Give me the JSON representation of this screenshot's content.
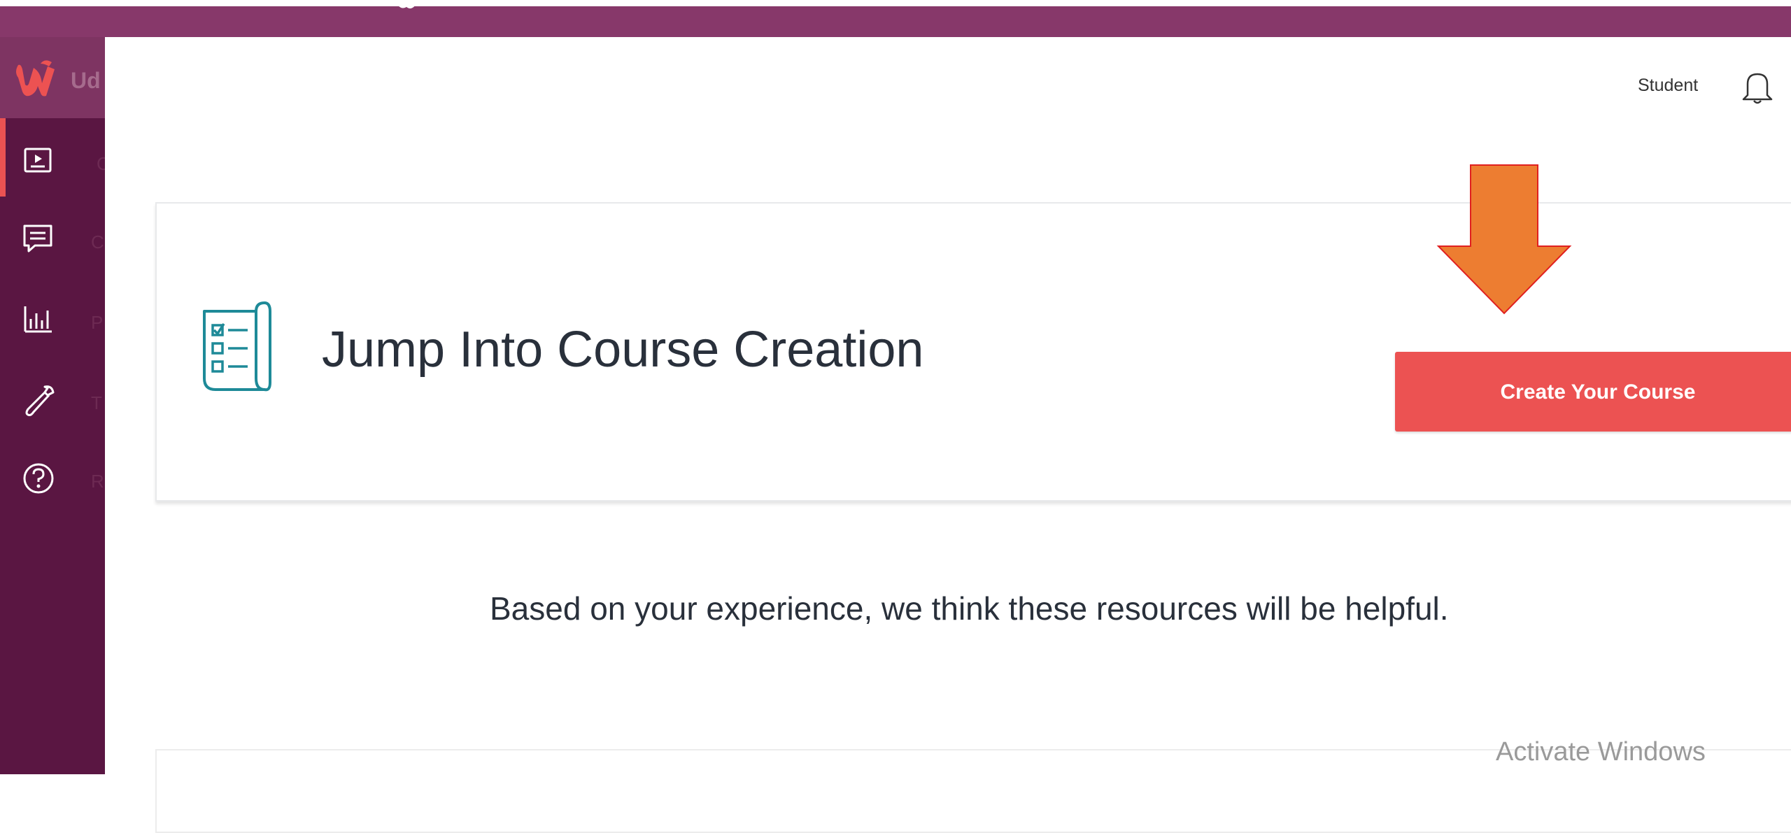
{
  "app": {
    "logo_text": "Ud",
    "icons": {
      "logo": "udemy-u-icon",
      "top_glyph": "handshake-icon"
    }
  },
  "sidebar": {
    "items": [
      {
        "name": "courses",
        "label": "C",
        "icon": "course-video-icon",
        "active": true
      },
      {
        "name": "communication",
        "label": "C",
        "icon": "chat-icon",
        "active": false
      },
      {
        "name": "performance",
        "label": "P",
        "icon": "bar-chart-icon",
        "active": false
      },
      {
        "name": "tools",
        "label": "T",
        "icon": "wrench-icon",
        "active": false
      },
      {
        "name": "resources",
        "label": "R",
        "icon": "help-circle-icon",
        "active": false
      }
    ],
    "colors": {
      "background": "#5a1642",
      "active_indicator": "#ec5252"
    }
  },
  "header": {
    "student_link": "Student",
    "bell_icon": "bell-icon"
  },
  "main": {
    "card": {
      "title": "Jump Into Course Creation",
      "icon": "checklist-scroll-icon",
      "button_label": "Create Your Course"
    },
    "helpful_text": "Based on your experience, we think these resources will be helpful."
  },
  "overlay": {
    "activate_windows": "Activate Windows",
    "annotation": "orange-down-arrow"
  },
  "colors": {
    "top_bar": "#87386a",
    "button": "#ec5252",
    "arrow_fill": "#ed7d31",
    "arrow_stroke": "#e02020",
    "icon_teal": "#1e8a98"
  }
}
